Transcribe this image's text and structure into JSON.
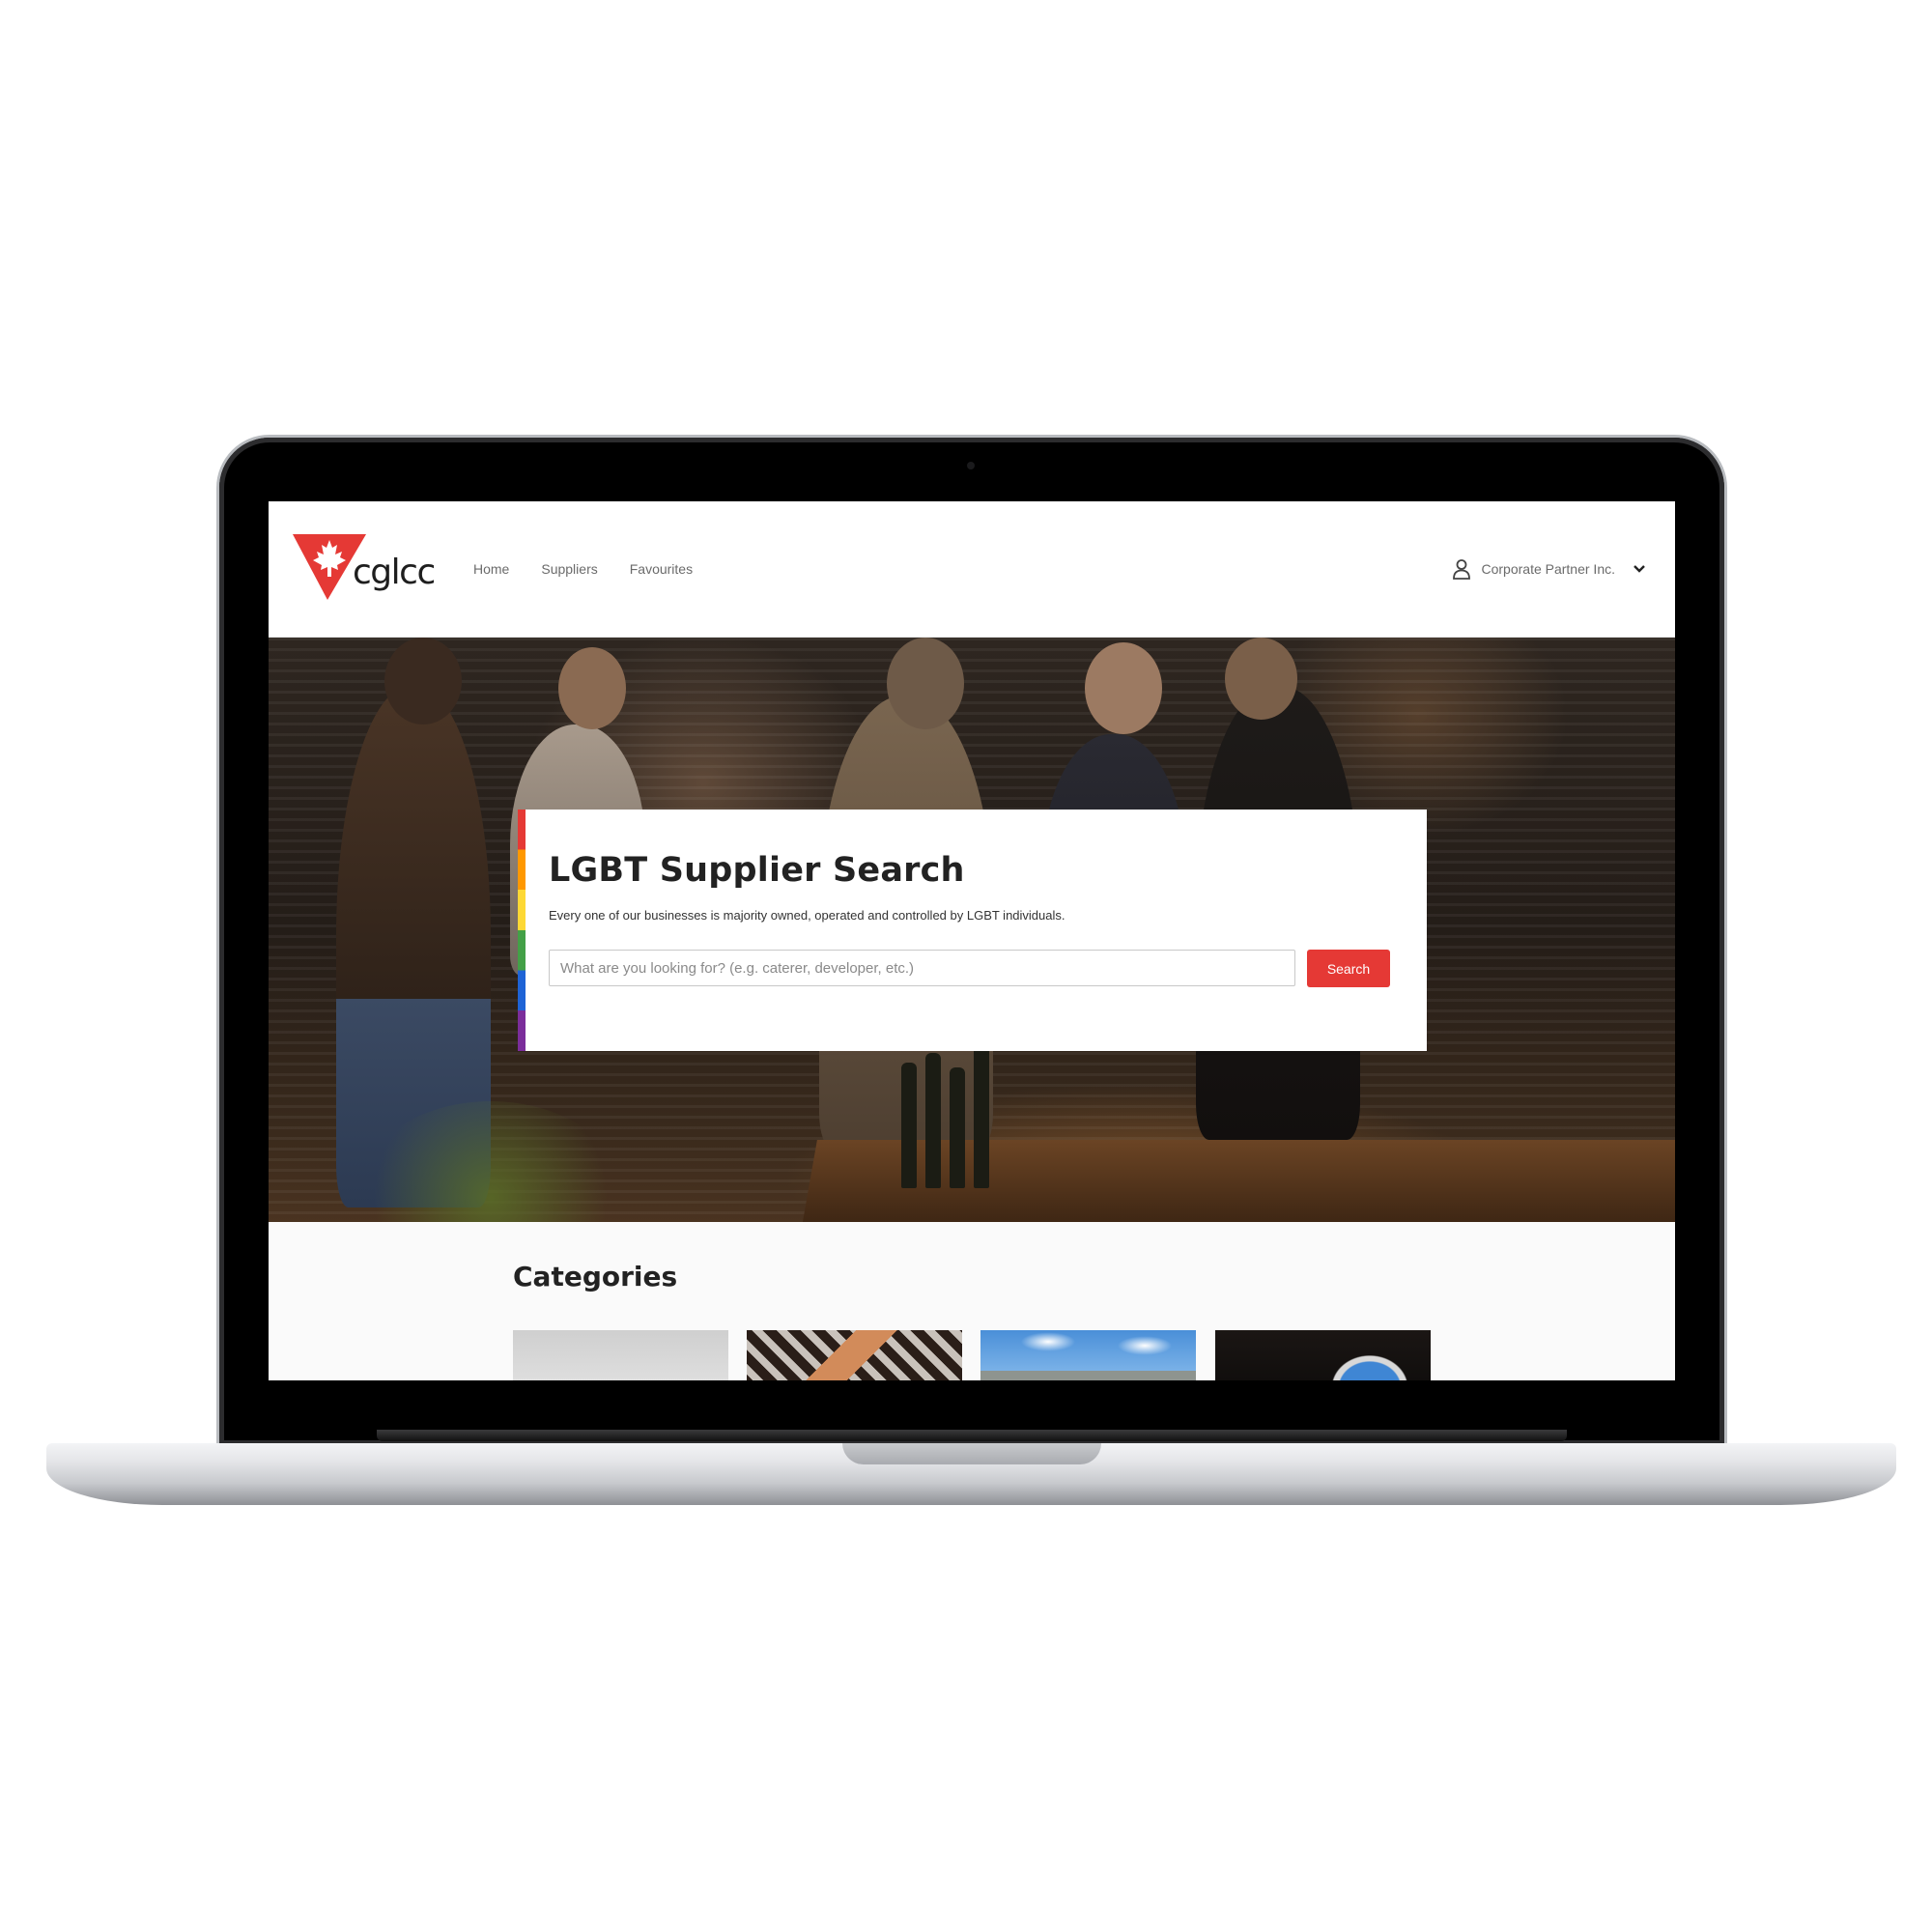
{
  "brand": {
    "name": "cglcc",
    "accent": "#e53935"
  },
  "nav": {
    "items": [
      {
        "label": "Home"
      },
      {
        "label": "Suppliers"
      },
      {
        "label": "Favourites"
      }
    ]
  },
  "account": {
    "label": "Corporate Partner Inc.",
    "icon": "user-icon",
    "menu_icon": "chevron-down-icon"
  },
  "hero": {
    "title": "LGBT Supplier Search",
    "subtitle": "Every one of our businesses is majority owned, operated and controlled by LGBT individuals.",
    "search": {
      "placeholder": "What are you looking for? (e.g. caterer, developer, etc.)",
      "value": "",
      "button_label": "Search"
    },
    "pride_colors": [
      "#e53935",
      "#ff9800",
      "#fdd835",
      "#43a047",
      "#1e63d6",
      "#7b2d9b"
    ]
  },
  "categories": {
    "title": "Categories"
  }
}
